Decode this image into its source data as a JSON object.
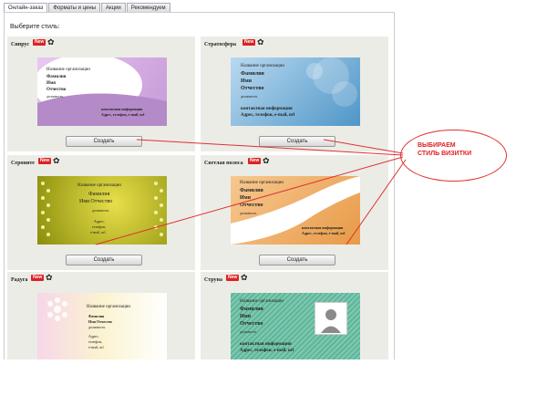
{
  "tabs": [
    "Онлайн-заказ",
    "Форматы и цены",
    "Акции",
    "Рекомендуем"
  ],
  "choose_label": "Выберите стиль:",
  "new_badge": "New",
  "button_label": "Создать",
  "cards": [
    {
      "name": "Сипрус",
      "lines": [
        "Название организации",
        "Фамилия",
        "Имя",
        "Отчество",
        "должность",
        "контактная информация",
        "Адрес, телефон, e-mail, url"
      ]
    },
    {
      "name": "Стратосфера",
      "lines": [
        "Название организации",
        "Фамилия",
        "Имя",
        "Отчество",
        "должность",
        "контактная информация",
        "Адрес, телефон, e-mail, url"
      ]
    },
    {
      "name": "Сероните",
      "lines": [
        "Название организации",
        "Фамилия",
        "Имя Отчество",
        "должность",
        "Адрес,",
        "телефон,",
        "e-mail, url"
      ]
    },
    {
      "name": "Светлая полоса",
      "lines": [
        "Название организации",
        "Фамилия",
        "Имя",
        "Отчество",
        "должность",
        "контактная информация",
        "Адрес, телефон, e-mail, url"
      ]
    },
    {
      "name": "Радуга",
      "lines": [
        "Название организации",
        "Фамилия",
        "Имя Отчество",
        "должность",
        "Адрес,",
        "телефон,",
        "e-mail, url"
      ]
    },
    {
      "name": "Струна",
      "lines": [
        "Название организации",
        "Фамилия",
        "Имя",
        "Отчество",
        "должность",
        "контактная информация",
        "Адрес, телефон, e-mail, url"
      ]
    }
  ],
  "annotation": "ВЫБИРАЕМ СТИЛЬ ВИЗИТКИ",
  "colors": {
    "annotation": "#e02020",
    "panel": "#ecece7"
  }
}
